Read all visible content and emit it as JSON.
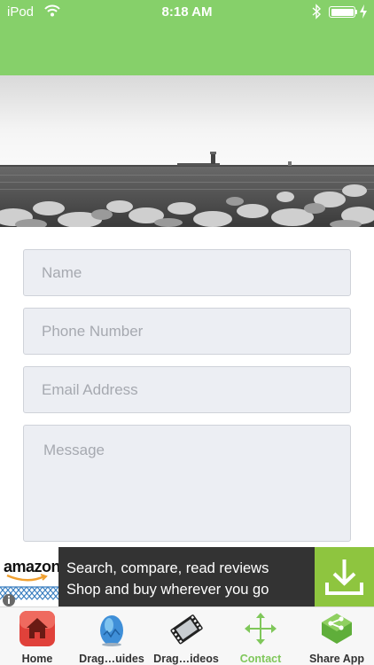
{
  "status_bar": {
    "carrier": "iPod",
    "time": "8:18 AM"
  },
  "form": {
    "name_placeholder": "Name",
    "phone_placeholder": "Phone Number",
    "email_placeholder": "Email Address",
    "message_placeholder": "Message"
  },
  "ad": {
    "brand": "amazon",
    "line1": "Search, compare, read reviews",
    "line2": "Shop and buy wherever you go"
  },
  "tabs": [
    {
      "label": "Home",
      "icon": "home-icon"
    },
    {
      "label": "Drag…uides",
      "icon": "dragon-egg-icon"
    },
    {
      "label": "Drag…ideos",
      "icon": "video-icon"
    },
    {
      "label": "Contact",
      "icon": "move-arrows-icon"
    },
    {
      "label": "Share App",
      "icon": "share-icon"
    }
  ],
  "colors": {
    "header": "#86d06a",
    "active_tab": "#7fc75a",
    "ad_download": "#8ec53f"
  }
}
